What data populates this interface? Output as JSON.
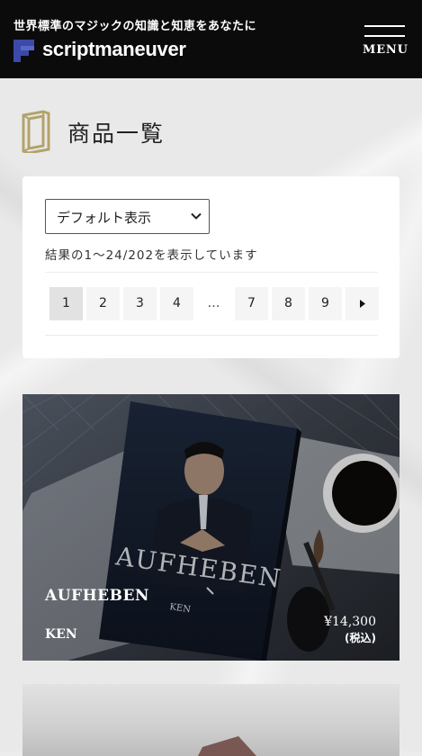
{
  "header": {
    "tagline": "世界標準のマジックの知識と知恵をあなたに",
    "logo_text": "scriptmaneuver",
    "menu_label": "MENU"
  },
  "page": {
    "title": "商品一覧"
  },
  "sort": {
    "selected": "デフォルト表示"
  },
  "results": {
    "text": "結果の1〜24/202を表示しています"
  },
  "pagination": {
    "pages": [
      "1",
      "2",
      "3",
      "4"
    ],
    "ellipsis": "…",
    "tail_pages": [
      "7",
      "8",
      "9"
    ],
    "current": "1",
    "next_icon": "caret-right-icon"
  },
  "products": [
    {
      "name": "AUFHEBEN",
      "author": "KEN",
      "price": "¥14,300",
      "tax_note": "(税込)",
      "cover_title": "AUFHEBEN",
      "cover_author": "KEN"
    }
  ],
  "colors": {
    "header_bg": "#0b0b0b",
    "accent_gold": "#b3a36a",
    "logo_blue": "#3b4aa8"
  }
}
